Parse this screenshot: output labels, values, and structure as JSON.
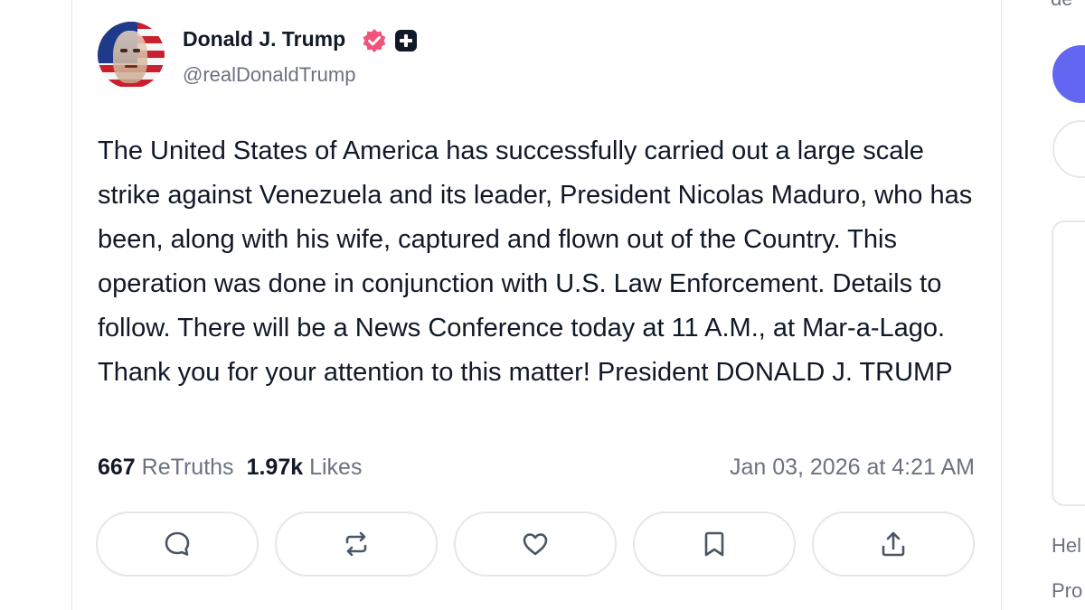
{
  "post": {
    "author": {
      "name": "Donald J. Trump",
      "handle": "@realDonaldTrump",
      "verified_color": "#f0547d",
      "plus_badge_color": "#111827"
    },
    "text": "The United States of America has successfully carried out a large scale strike against Venezuela and its leader, President Nicolas Maduro, who has been, along with his wife, captured and flown out of the Country. This operation was done in conjunction with U.S. Law Enforcement. Details to follow. There will be a News Conference today at 11 A.M., at Mar-a-Lago. Thank you for your attention to this matter! President DONALD J. TRUMP",
    "stats": {
      "retruths_count": "667",
      "retruths_label": "ReTruths",
      "likes_count": "1.97k",
      "likes_label": "Likes"
    },
    "timestamp": "Jan 03, 2026 at 4:21 AM",
    "actions": [
      {
        "name": "reply",
        "icon": "comment-icon"
      },
      {
        "name": "retruth",
        "icon": "repost-icon"
      },
      {
        "name": "like",
        "icon": "heart-icon"
      },
      {
        "name": "bookmark",
        "icon": "bookmark-icon"
      },
      {
        "name": "share",
        "icon": "share-icon"
      }
    ]
  },
  "sidebar": {
    "top_text": "de",
    "accent_color": "#6366f1",
    "links": [
      "Hel",
      "Pro"
    ]
  }
}
